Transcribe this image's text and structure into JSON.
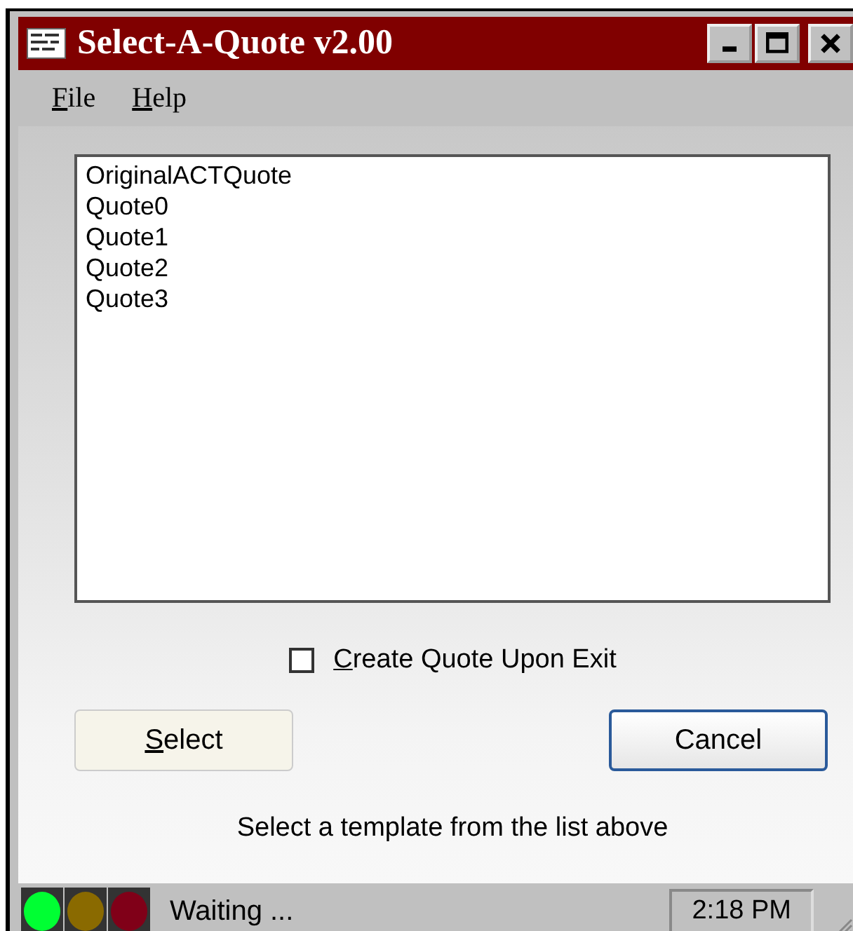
{
  "window": {
    "title": "Select-A-Quote v2.00"
  },
  "menu": [
    "File",
    "Help"
  ],
  "list": {
    "items": [
      {
        "label": "OriginalACTQuote",
        "selected": false
      },
      {
        "label": "Quote0",
        "selected": false
      },
      {
        "label": "Quote1",
        "selected": false
      },
      {
        "label": "Quote2",
        "selected": false
      },
      {
        "label": "Quote3",
        "selected": false
      }
    ]
  },
  "checkbox": {
    "label": "Create Quote Upon Exit",
    "checked": false
  },
  "buttons": [
    {
      "label": "Select",
      "default": false
    },
    {
      "label": "Cancel",
      "default": true
    }
  ],
  "hint": "Select a template from the list above",
  "status_bar": {
    "lights": [
      {
        "color": "#00ff33"
      },
      {
        "color": "#8a6a00"
      },
      {
        "color": "#800018"
      }
    ],
    "status": "Waiting ...",
    "time": "2:18 PM"
  }
}
